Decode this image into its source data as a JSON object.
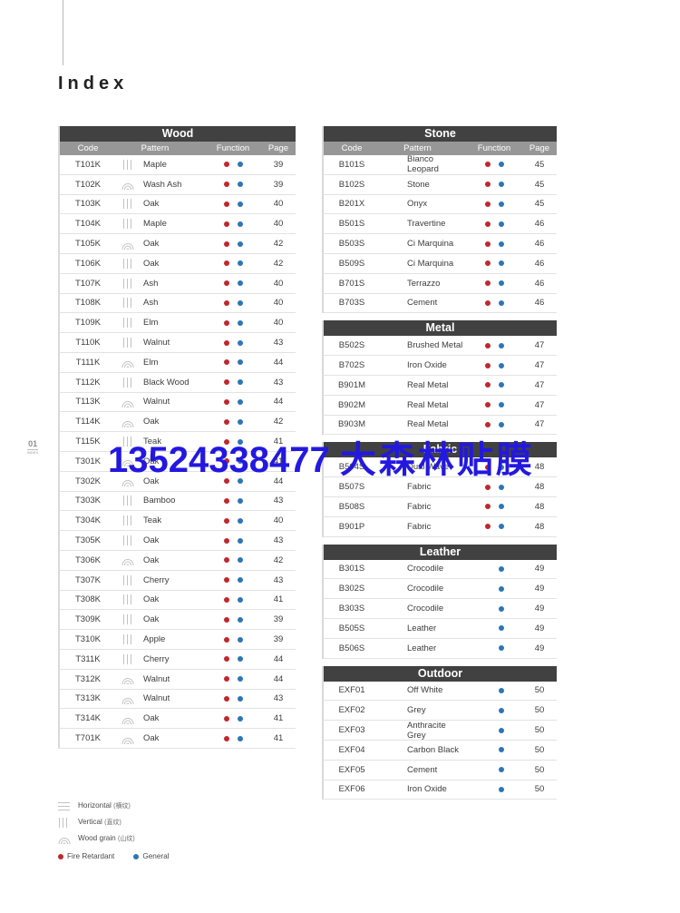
{
  "page": {
    "title": "Index",
    "marker_number": "01",
    "marker_sub": "INDEX",
    "watermark_phone": "13524338477",
    "watermark_text": "大森林贴膜"
  },
  "colors": {
    "title_bar": "#414141",
    "subhead_bar": "#979797",
    "fire_retardant": "#c0272d",
    "general": "#2e75b6"
  },
  "columns": {
    "code": "Code",
    "pattern": "Pattern",
    "function": "Function",
    "page": "Page"
  },
  "legend": {
    "items": [
      {
        "icon": "horizontal-icon",
        "label": "Horizontal",
        "cn": "(横纹)"
      },
      {
        "icon": "vertical-icon",
        "label": "Vertical",
        "cn": "(直纹)"
      },
      {
        "icon": "wood-grain-icon",
        "label": "Wood grain",
        "cn": "(山纹)"
      }
    ],
    "dots": [
      {
        "color_key": "fire_retardant",
        "label": "Fire Retardant"
      },
      {
        "color_key": "general",
        "label": "General"
      }
    ]
  },
  "tables": [
    {
      "id": "wood",
      "title": "Wood",
      "side": "left",
      "show_subhead": true,
      "rows": [
        {
          "code": "T101K",
          "icon": "vertical-icon",
          "pattern": "Maple",
          "fr": true,
          "gn": true,
          "page": "39"
        },
        {
          "code": "T102K",
          "icon": "wood-grain-icon",
          "pattern": "Wash Ash",
          "fr": true,
          "gn": true,
          "page": "39"
        },
        {
          "code": "T103K",
          "icon": "vertical-icon",
          "pattern": "Oak",
          "fr": true,
          "gn": true,
          "page": "40"
        },
        {
          "code": "T104K",
          "icon": "vertical-icon",
          "pattern": "Maple",
          "fr": true,
          "gn": true,
          "page": "40"
        },
        {
          "code": "T105K",
          "icon": "wood-grain-icon",
          "pattern": "Oak",
          "fr": true,
          "gn": true,
          "page": "42"
        },
        {
          "code": "T106K",
          "icon": "vertical-icon",
          "pattern": "Oak",
          "fr": true,
          "gn": true,
          "page": "42"
        },
        {
          "code": "T107K",
          "icon": "vertical-icon",
          "pattern": "Ash",
          "fr": true,
          "gn": true,
          "page": "40"
        },
        {
          "code": "T108K",
          "icon": "vertical-icon",
          "pattern": "Ash",
          "fr": true,
          "gn": true,
          "page": "40"
        },
        {
          "code": "T109K",
          "icon": "vertical-icon",
          "pattern": "Elm",
          "fr": true,
          "gn": true,
          "page": "40"
        },
        {
          "code": "T110K",
          "icon": "vertical-icon",
          "pattern": "Walnut",
          "fr": true,
          "gn": true,
          "page": "43"
        },
        {
          "code": "T111K",
          "icon": "wood-grain-icon",
          "pattern": "Elm",
          "fr": true,
          "gn": true,
          "page": "44"
        },
        {
          "code": "T112K",
          "icon": "vertical-icon",
          "pattern": "Black Wood",
          "fr": true,
          "gn": true,
          "page": "43"
        },
        {
          "code": "T113K",
          "icon": "wood-grain-icon",
          "pattern": "Walnut",
          "fr": true,
          "gn": true,
          "page": "44"
        },
        {
          "code": "T114K",
          "icon": "wood-grain-icon",
          "pattern": "Oak",
          "fr": true,
          "gn": true,
          "page": "42"
        },
        {
          "code": "T115K",
          "icon": "vertical-icon",
          "pattern": "Teak",
          "fr": true,
          "gn": true,
          "page": "41"
        },
        {
          "code": "T301K",
          "icon": "wood-grain-icon",
          "pattern": "Oak",
          "fr": true,
          "gn": true,
          "page": "41"
        },
        {
          "code": "T302K",
          "icon": "wood-grain-icon",
          "pattern": "Oak",
          "fr": true,
          "gn": true,
          "page": "44"
        },
        {
          "code": "T303K",
          "icon": "vertical-icon",
          "pattern": "Bamboo",
          "fr": true,
          "gn": true,
          "page": "43"
        },
        {
          "code": "T304K",
          "icon": "vertical-icon",
          "pattern": "Teak",
          "fr": true,
          "gn": true,
          "page": "40"
        },
        {
          "code": "T305K",
          "icon": "vertical-icon",
          "pattern": "Oak",
          "fr": true,
          "gn": true,
          "page": "43"
        },
        {
          "code": "T306K",
          "icon": "wood-grain-icon",
          "pattern": "Oak",
          "fr": true,
          "gn": true,
          "page": "42"
        },
        {
          "code": "T307K",
          "icon": "vertical-icon",
          "pattern": "Cherry",
          "fr": true,
          "gn": true,
          "page": "43"
        },
        {
          "code": "T308K",
          "icon": "vertical-icon",
          "pattern": "Oak",
          "fr": true,
          "gn": true,
          "page": "41"
        },
        {
          "code": "T309K",
          "icon": "vertical-icon",
          "pattern": "Oak",
          "fr": true,
          "gn": true,
          "page": "39"
        },
        {
          "code": "T310K",
          "icon": "vertical-icon",
          "pattern": "Apple",
          "fr": true,
          "gn": true,
          "page": "39"
        },
        {
          "code": "T311K",
          "icon": "vertical-icon",
          "pattern": "Cherry",
          "fr": true,
          "gn": true,
          "page": "44"
        },
        {
          "code": "T312K",
          "icon": "wood-grain-icon",
          "pattern": "Walnut",
          "fr": true,
          "gn": true,
          "page": "44"
        },
        {
          "code": "T313K",
          "icon": "wood-grain-icon",
          "pattern": "Walnut",
          "fr": true,
          "gn": true,
          "page": "43"
        },
        {
          "code": "T314K",
          "icon": "wood-grain-icon",
          "pattern": "Oak",
          "fr": true,
          "gn": true,
          "page": "41"
        },
        {
          "code": "T701K",
          "icon": "wood-grain-icon",
          "pattern": "Oak",
          "fr": true,
          "gn": true,
          "page": "41"
        }
      ]
    },
    {
      "id": "stone",
      "title": "Stone",
      "side": "right",
      "show_subhead": true,
      "rows": [
        {
          "code": "B101S",
          "icon": "",
          "pattern": "Bianco Leopard",
          "fr": true,
          "gn": true,
          "page": "45"
        },
        {
          "code": "B102S",
          "icon": "",
          "pattern": "Stone",
          "fr": true,
          "gn": true,
          "page": "45"
        },
        {
          "code": "B201X",
          "icon": "",
          "pattern": "Onyx",
          "fr": true,
          "gn": true,
          "page": "45"
        },
        {
          "code": "B501S",
          "icon": "",
          "pattern": "Travertine",
          "fr": true,
          "gn": true,
          "page": "46"
        },
        {
          "code": "B503S",
          "icon": "",
          "pattern": "Ci Marquina",
          "fr": true,
          "gn": true,
          "page": "46"
        },
        {
          "code": "B509S",
          "icon": "",
          "pattern": "Ci Marquina",
          "fr": true,
          "gn": true,
          "page": "46"
        },
        {
          "code": "B701S",
          "icon": "",
          "pattern": "Terrazzo",
          "fr": true,
          "gn": true,
          "page": "46"
        },
        {
          "code": "B703S",
          "icon": "",
          "pattern": "Cement",
          "fr": true,
          "gn": true,
          "page": "46"
        }
      ]
    },
    {
      "id": "metal",
      "title": "Metal",
      "side": "right",
      "show_subhead": false,
      "rows": [
        {
          "code": "B502S",
          "icon": "",
          "pattern": "Brushed Metal",
          "fr": true,
          "gn": true,
          "page": "47"
        },
        {
          "code": "B702S",
          "icon": "",
          "pattern": "Iron Oxide",
          "fr": true,
          "gn": true,
          "page": "47"
        },
        {
          "code": "B901M",
          "icon": "",
          "pattern": "Real Metal",
          "fr": true,
          "gn": true,
          "page": "47"
        },
        {
          "code": "B902M",
          "icon": "",
          "pattern": "Real Metal",
          "fr": true,
          "gn": true,
          "page": "47"
        },
        {
          "code": "B903M",
          "icon": "",
          "pattern": "Real Metal",
          "fr": true,
          "gn": true,
          "page": "47"
        }
      ]
    },
    {
      "id": "fabric",
      "title": "Fabric",
      "side": "right",
      "show_subhead": false,
      "rows": [
        {
          "code": "B504S",
          "icon": "",
          "pattern": "Dual Wave",
          "fr": true,
          "gn": true,
          "page": "48"
        },
        {
          "code": "B507S",
          "icon": "",
          "pattern": "Fabric",
          "fr": true,
          "gn": true,
          "page": "48"
        },
        {
          "code": "B508S",
          "icon": "",
          "pattern": "Fabric",
          "fr": true,
          "gn": true,
          "page": "48"
        },
        {
          "code": "B901P",
          "icon": "",
          "pattern": "Fabric",
          "fr": true,
          "gn": true,
          "page": "48"
        }
      ]
    },
    {
      "id": "leather",
      "title": "Leather",
      "side": "right",
      "show_subhead": false,
      "rows": [
        {
          "code": "B301S",
          "icon": "",
          "pattern": "Crocodile",
          "fr": false,
          "gn": true,
          "page": "49"
        },
        {
          "code": "B302S",
          "icon": "",
          "pattern": "Crocodile",
          "fr": false,
          "gn": true,
          "page": "49"
        },
        {
          "code": "B303S",
          "icon": "",
          "pattern": "Crocodile",
          "fr": false,
          "gn": true,
          "page": "49"
        },
        {
          "code": "B505S",
          "icon": "",
          "pattern": "Leather",
          "fr": false,
          "gn": true,
          "page": "49"
        },
        {
          "code": "B506S",
          "icon": "",
          "pattern": "Leather",
          "fr": false,
          "gn": true,
          "page": "49"
        }
      ]
    },
    {
      "id": "outdoor",
      "title": "Outdoor",
      "side": "right",
      "show_subhead": false,
      "rows": [
        {
          "code": "EXF01",
          "icon": "",
          "pattern": "Off White",
          "fr": false,
          "gn": true,
          "page": "50"
        },
        {
          "code": "EXF02",
          "icon": "",
          "pattern": "Grey",
          "fr": false,
          "gn": true,
          "page": "50"
        },
        {
          "code": "EXF03",
          "icon": "",
          "pattern": "Anthracite Grey",
          "fr": false,
          "gn": true,
          "page": "50"
        },
        {
          "code": "EXF04",
          "icon": "",
          "pattern": "Carbon Black",
          "fr": false,
          "gn": true,
          "page": "50"
        },
        {
          "code": "EXF05",
          "icon": "",
          "pattern": "Cement",
          "fr": false,
          "gn": true,
          "page": "50"
        },
        {
          "code": "EXF06",
          "icon": "",
          "pattern": "Iron Oxide",
          "fr": false,
          "gn": true,
          "page": "50"
        }
      ]
    }
  ]
}
